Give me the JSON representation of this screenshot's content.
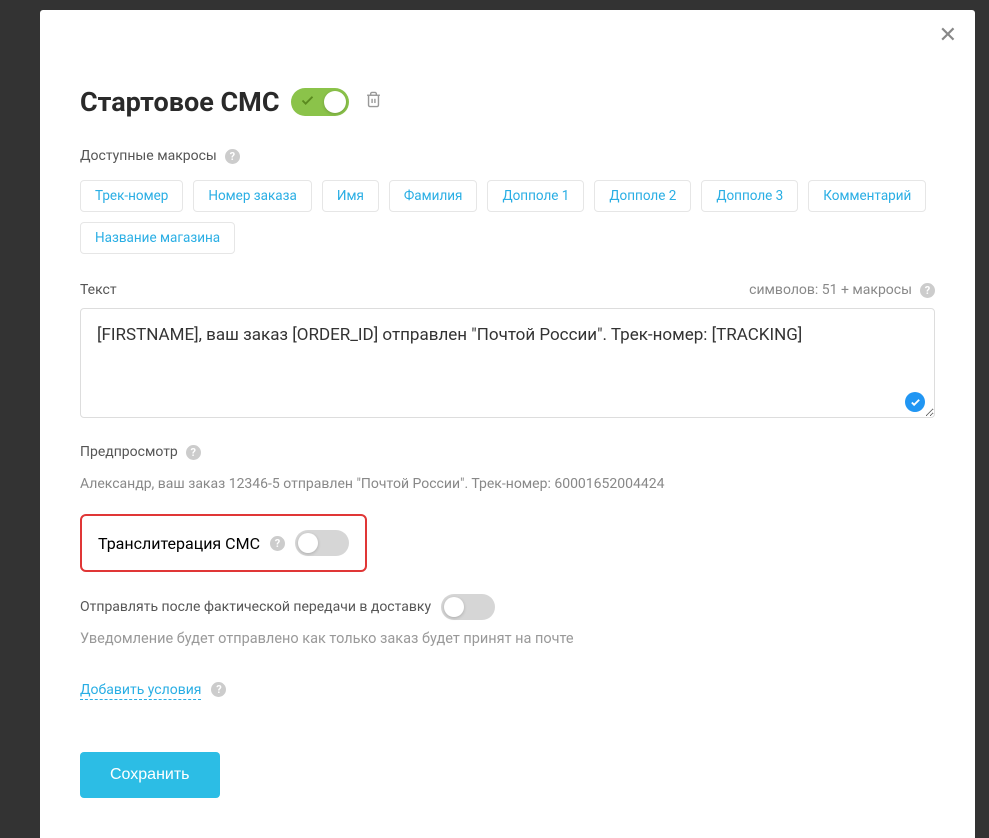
{
  "modal": {
    "title": "Стартовое СМС",
    "enabled": true
  },
  "macros": {
    "label": "Доступные макросы",
    "items": [
      "Трек-номер",
      "Номер заказа",
      "Имя",
      "Фамилия",
      "Допполе 1",
      "Допполе 2",
      "Допполе 3",
      "Комментарий",
      "Название магазина"
    ]
  },
  "text": {
    "label": "Текст",
    "char_count": "символов: 51 + макросы",
    "value": "[FIRSTNAME], ваш заказ [ORDER_ID] отправлен \"Почтой России\". Трек-номер: [TRACKING]"
  },
  "preview": {
    "label": "Предпросмотр",
    "value": "Александр, ваш заказ 12346-5 отправлен \"Почтой России\". Трек-номер: 60001652004424"
  },
  "translit": {
    "label": "Транслитерация СМС",
    "enabled": false
  },
  "send_after": {
    "label": "Отправлять после фактической передачи в доставку",
    "enabled": false,
    "hint": "Уведомление будет отправлено как только заказ будет принят на почте"
  },
  "conditions": {
    "link": "Добавить условия"
  },
  "actions": {
    "save": "Сохранить"
  }
}
